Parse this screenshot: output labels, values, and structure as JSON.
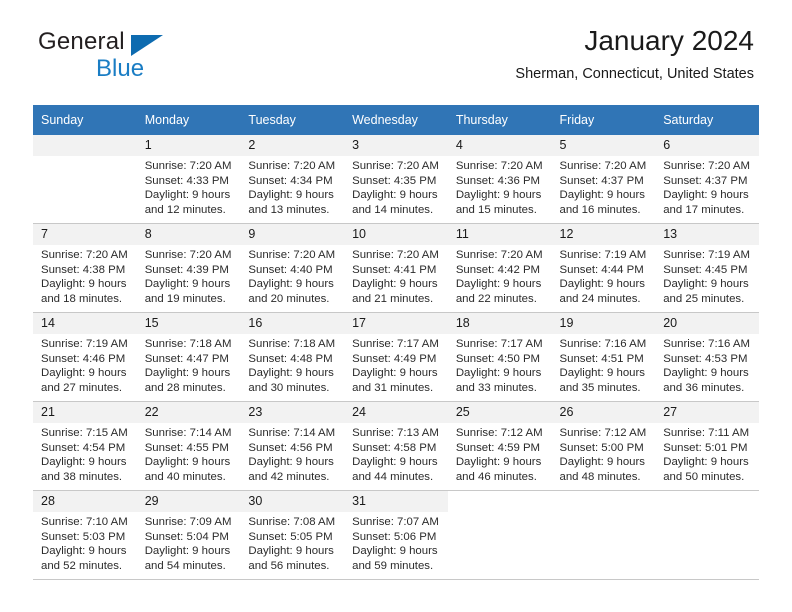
{
  "brand": {
    "name_part1": "General",
    "name_part2": "Blue"
  },
  "header": {
    "title": "January 2024",
    "subtitle": "Sherman, Connecticut, United States"
  },
  "colors": {
    "header_blue": "#3075B6",
    "brand_blue": "#1A7DC4",
    "daynum_band": "#F2F2F2",
    "grid_line": "#C8C8C8"
  },
  "weekday_headers": [
    "Sunday",
    "Monday",
    "Tuesday",
    "Wednesday",
    "Thursday",
    "Friday",
    "Saturday"
  ],
  "labels": {
    "sunrise_prefix": "Sunrise:",
    "sunset_prefix": "Sunset:",
    "daylight_prefix": "Daylight:"
  },
  "weeks": [
    [
      {
        "day": "",
        "empty": true
      },
      {
        "day": "1",
        "sunrise": "Sunrise: 7:20 AM",
        "sunset": "Sunset: 4:33 PM",
        "daylight_line1": "Daylight: 9 hours",
        "daylight_line2": "and 12 minutes."
      },
      {
        "day": "2",
        "sunrise": "Sunrise: 7:20 AM",
        "sunset": "Sunset: 4:34 PM",
        "daylight_line1": "Daylight: 9 hours",
        "daylight_line2": "and 13 minutes."
      },
      {
        "day": "3",
        "sunrise": "Sunrise: 7:20 AM",
        "sunset": "Sunset: 4:35 PM",
        "daylight_line1": "Daylight: 9 hours",
        "daylight_line2": "and 14 minutes."
      },
      {
        "day": "4",
        "sunrise": "Sunrise: 7:20 AM",
        "sunset": "Sunset: 4:36 PM",
        "daylight_line1": "Daylight: 9 hours",
        "daylight_line2": "and 15 minutes."
      },
      {
        "day": "5",
        "sunrise": "Sunrise: 7:20 AM",
        "sunset": "Sunset: 4:37 PM",
        "daylight_line1": "Daylight: 9 hours",
        "daylight_line2": "and 16 minutes."
      },
      {
        "day": "6",
        "sunrise": "Sunrise: 7:20 AM",
        "sunset": "Sunset: 4:37 PM",
        "daylight_line1": "Daylight: 9 hours",
        "daylight_line2": "and 17 minutes."
      }
    ],
    [
      {
        "day": "7",
        "sunrise": "Sunrise: 7:20 AM",
        "sunset": "Sunset: 4:38 PM",
        "daylight_line1": "Daylight: 9 hours",
        "daylight_line2": "and 18 minutes."
      },
      {
        "day": "8",
        "sunrise": "Sunrise: 7:20 AM",
        "sunset": "Sunset: 4:39 PM",
        "daylight_line1": "Daylight: 9 hours",
        "daylight_line2": "and 19 minutes."
      },
      {
        "day": "9",
        "sunrise": "Sunrise: 7:20 AM",
        "sunset": "Sunset: 4:40 PM",
        "daylight_line1": "Daylight: 9 hours",
        "daylight_line2": "and 20 minutes."
      },
      {
        "day": "10",
        "sunrise": "Sunrise: 7:20 AM",
        "sunset": "Sunset: 4:41 PM",
        "daylight_line1": "Daylight: 9 hours",
        "daylight_line2": "and 21 minutes."
      },
      {
        "day": "11",
        "sunrise": "Sunrise: 7:20 AM",
        "sunset": "Sunset: 4:42 PM",
        "daylight_line1": "Daylight: 9 hours",
        "daylight_line2": "and 22 minutes."
      },
      {
        "day": "12",
        "sunrise": "Sunrise: 7:19 AM",
        "sunset": "Sunset: 4:44 PM",
        "daylight_line1": "Daylight: 9 hours",
        "daylight_line2": "and 24 minutes."
      },
      {
        "day": "13",
        "sunrise": "Sunrise: 7:19 AM",
        "sunset": "Sunset: 4:45 PM",
        "daylight_line1": "Daylight: 9 hours",
        "daylight_line2": "and 25 minutes."
      }
    ],
    [
      {
        "day": "14",
        "sunrise": "Sunrise: 7:19 AM",
        "sunset": "Sunset: 4:46 PM",
        "daylight_line1": "Daylight: 9 hours",
        "daylight_line2": "and 27 minutes."
      },
      {
        "day": "15",
        "sunrise": "Sunrise: 7:18 AM",
        "sunset": "Sunset: 4:47 PM",
        "daylight_line1": "Daylight: 9 hours",
        "daylight_line2": "and 28 minutes."
      },
      {
        "day": "16",
        "sunrise": "Sunrise: 7:18 AM",
        "sunset": "Sunset: 4:48 PM",
        "daylight_line1": "Daylight: 9 hours",
        "daylight_line2": "and 30 minutes."
      },
      {
        "day": "17",
        "sunrise": "Sunrise: 7:17 AM",
        "sunset": "Sunset: 4:49 PM",
        "daylight_line1": "Daylight: 9 hours",
        "daylight_line2": "and 31 minutes."
      },
      {
        "day": "18",
        "sunrise": "Sunrise: 7:17 AM",
        "sunset": "Sunset: 4:50 PM",
        "daylight_line1": "Daylight: 9 hours",
        "daylight_line2": "and 33 minutes."
      },
      {
        "day": "19",
        "sunrise": "Sunrise: 7:16 AM",
        "sunset": "Sunset: 4:51 PM",
        "daylight_line1": "Daylight: 9 hours",
        "daylight_line2": "and 35 minutes."
      },
      {
        "day": "20",
        "sunrise": "Sunrise: 7:16 AM",
        "sunset": "Sunset: 4:53 PM",
        "daylight_line1": "Daylight: 9 hours",
        "daylight_line2": "and 36 minutes."
      }
    ],
    [
      {
        "day": "21",
        "sunrise": "Sunrise: 7:15 AM",
        "sunset": "Sunset: 4:54 PM",
        "daylight_line1": "Daylight: 9 hours",
        "daylight_line2": "and 38 minutes."
      },
      {
        "day": "22",
        "sunrise": "Sunrise: 7:14 AM",
        "sunset": "Sunset: 4:55 PM",
        "daylight_line1": "Daylight: 9 hours",
        "daylight_line2": "and 40 minutes."
      },
      {
        "day": "23",
        "sunrise": "Sunrise: 7:14 AM",
        "sunset": "Sunset: 4:56 PM",
        "daylight_line1": "Daylight: 9 hours",
        "daylight_line2": "and 42 minutes."
      },
      {
        "day": "24",
        "sunrise": "Sunrise: 7:13 AM",
        "sunset": "Sunset: 4:58 PM",
        "daylight_line1": "Daylight: 9 hours",
        "daylight_line2": "and 44 minutes."
      },
      {
        "day": "25",
        "sunrise": "Sunrise: 7:12 AM",
        "sunset": "Sunset: 4:59 PM",
        "daylight_line1": "Daylight: 9 hours",
        "daylight_line2": "and 46 minutes."
      },
      {
        "day": "26",
        "sunrise": "Sunrise: 7:12 AM",
        "sunset": "Sunset: 5:00 PM",
        "daylight_line1": "Daylight: 9 hours",
        "daylight_line2": "and 48 minutes."
      },
      {
        "day": "27",
        "sunrise": "Sunrise: 7:11 AM",
        "sunset": "Sunset: 5:01 PM",
        "daylight_line1": "Daylight: 9 hours",
        "daylight_line2": "and 50 minutes."
      }
    ],
    [
      {
        "day": "28",
        "sunrise": "Sunrise: 7:10 AM",
        "sunset": "Sunset: 5:03 PM",
        "daylight_line1": "Daylight: 9 hours",
        "daylight_line2": "and 52 minutes."
      },
      {
        "day": "29",
        "sunrise": "Sunrise: 7:09 AM",
        "sunset": "Sunset: 5:04 PM",
        "daylight_line1": "Daylight: 9 hours",
        "daylight_line2": "and 54 minutes."
      },
      {
        "day": "30",
        "sunrise": "Sunrise: 7:08 AM",
        "sunset": "Sunset: 5:05 PM",
        "daylight_line1": "Daylight: 9 hours",
        "daylight_line2": "and 56 minutes."
      },
      {
        "day": "31",
        "sunrise": "Sunrise: 7:07 AM",
        "sunset": "Sunset: 5:06 PM",
        "daylight_line1": "Daylight: 9 hours",
        "daylight_line2": "and 59 minutes."
      },
      {
        "day": "",
        "empty": true,
        "blank": true
      },
      {
        "day": "",
        "empty": true,
        "blank": true
      },
      {
        "day": "",
        "empty": true,
        "blank": true
      }
    ]
  ]
}
